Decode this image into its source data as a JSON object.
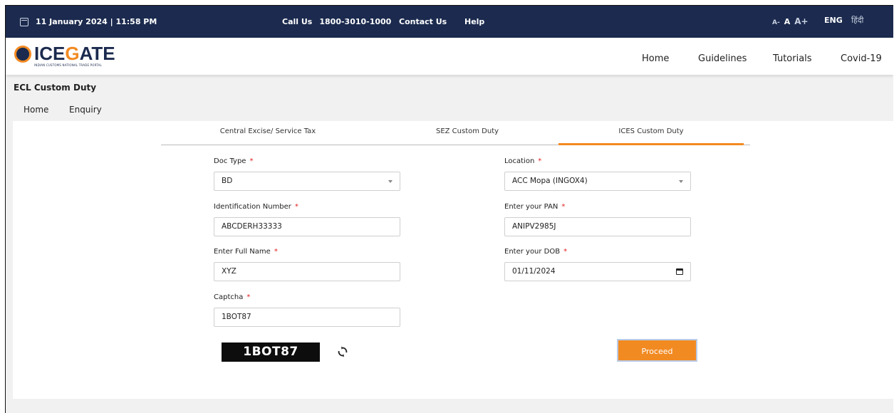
{
  "topbar": {
    "datetime": "11 January 2024 | 11:58 PM",
    "call_label": "Call Us",
    "call_number": "1800-3010-1000",
    "contact_label": "Contact Us",
    "help_label": "Help",
    "font_small": "A-",
    "font_normal": "A",
    "font_large": "A+",
    "lang_en": "ENG",
    "lang_hi": "हिंदी",
    "calendar_icon": "calendar-icon"
  },
  "header": {
    "logo_prefix": "ICE",
    "logo_suffix": "ATE",
    "logo_tagline": "INDIAN CUSTOMS NATIONAL TRADE PORTAL",
    "nav": [
      "Home",
      "Guidelines",
      "Tutorials",
      "Covid-19"
    ]
  },
  "page": {
    "title": "ECL Custom Duty",
    "subnav": [
      "Home",
      "Enquiry"
    ]
  },
  "tabs": [
    {
      "label": "Central Excise/ Service Tax",
      "active": false
    },
    {
      "label": "SEZ Custom Duty",
      "active": false
    },
    {
      "label": "ICES Custom Duty",
      "active": true
    }
  ],
  "form": {
    "doc_type_label": "Doc Type",
    "doc_type_value": "BD",
    "location_label": "Location",
    "location_value": "ACC Mopa (INGOX4)",
    "id_number_label": "Identification Number",
    "id_number_value": "ABCDERH33333",
    "pan_label": "Enter your PAN",
    "pan_value": "ANIPV2985J",
    "full_name_label": "Enter Full Name",
    "full_name_value": "XYZ",
    "dob_label": "Enter your DOB",
    "dob_value": "01/11/2024",
    "captcha_label": "Captcha",
    "captcha_value": "1BOT87",
    "required_mark": "*",
    "captcha_image_text": "1BOT87",
    "proceed_label": "Proceed"
  },
  "colors": {
    "topbar_bg": "#1b2a4e",
    "accent": "#f28a22",
    "required": "#e02020"
  }
}
